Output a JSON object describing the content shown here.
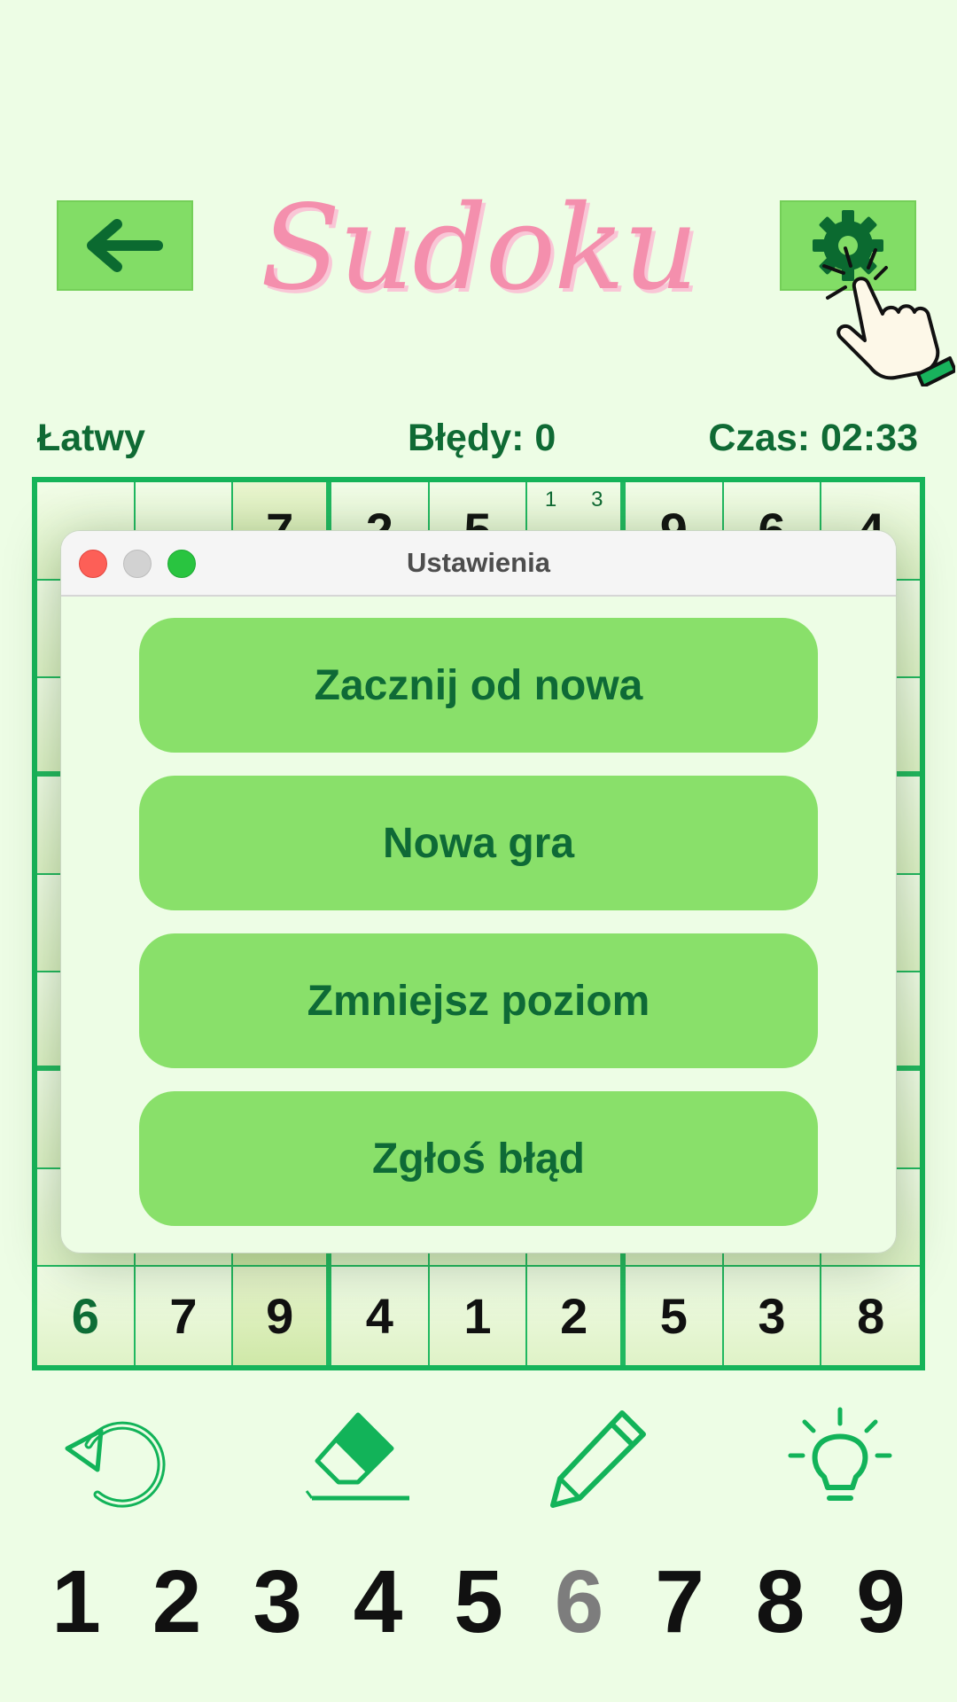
{
  "header": {
    "title": "Sudoku",
    "back_icon": "arrow-left-icon",
    "settings_icon": "gear-icon"
  },
  "status": {
    "level": "Łatwy",
    "errors": "Błędy: 0",
    "timer": "Czas: 02:33"
  },
  "board": {
    "row1": [
      "",
      "",
      "7",
      "2",
      "5",
      "",
      "9",
      "6",
      "4"
    ],
    "row1_notes": [
      "1",
      "3"
    ],
    "row9": [
      "6",
      "7",
      "9",
      "4",
      "1",
      "2",
      "5",
      "3",
      "8"
    ]
  },
  "dialog": {
    "title": "Ustawienia",
    "buttons": [
      "Zacznij od nowa",
      "Nowa gra",
      "Zmniejsz poziom",
      "Zgłoś błąd"
    ]
  },
  "tools": [
    "undo-icon",
    "eraser-icon",
    "pencil-icon",
    "lightbulb-icon"
  ],
  "numpad": [
    "1",
    "2",
    "3",
    "4",
    "5",
    "6",
    "7",
    "8",
    "9"
  ],
  "numpad_dimmed": "6",
  "colors": {
    "background": "#edfde5",
    "accent_green": "#16b45a",
    "button_green": "#89e06a",
    "title_pink": "#f48fad"
  }
}
